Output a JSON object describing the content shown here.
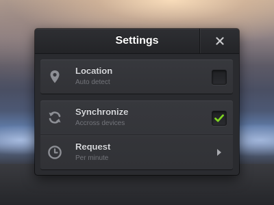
{
  "dialog": {
    "title": "Settings",
    "close_icon": "close-icon"
  },
  "settings": [
    {
      "title": "Location",
      "subtitle": "Auto detect",
      "icon": "location-pin-icon",
      "control": "checkbox",
      "checked": false
    },
    {
      "title": "Synchronize",
      "subtitle": "Accross devices",
      "icon": "sync-icon",
      "control": "checkbox",
      "checked": true
    },
    {
      "title": "Request",
      "subtitle": "Per minute",
      "icon": "clock-icon",
      "control": "chevron"
    }
  ],
  "colors": {
    "checkmark": "#7ed321",
    "panel": "#2a2b2f",
    "card": "#37383d"
  }
}
